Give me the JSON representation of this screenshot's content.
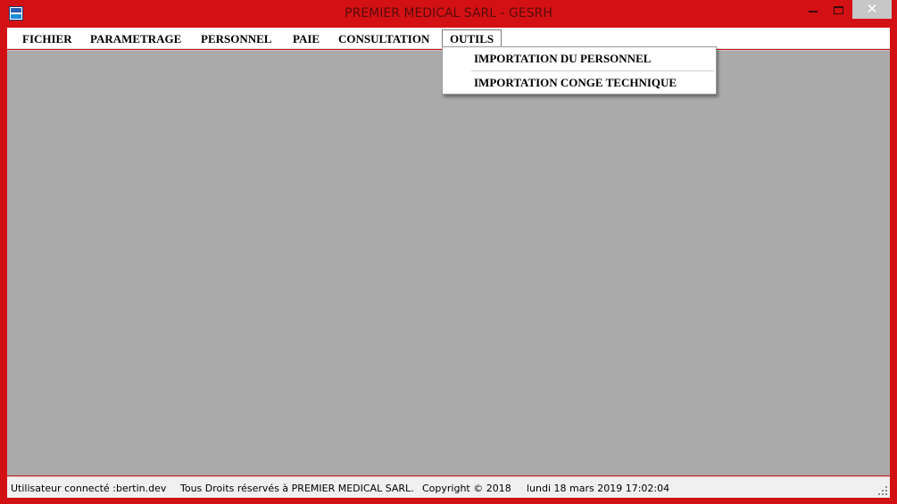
{
  "window": {
    "title": "PREMIER MEDICAL SARL - GESRH",
    "controls": {
      "minimize_icon": "minimize-icon",
      "maximize_icon": "maximize-icon",
      "close_glyph": "✕"
    }
  },
  "colors": {
    "frame": "#d31115",
    "client_background": "#aaaaaa",
    "menubar_background": "#ffffff",
    "statusbar_background": "#f0f0f0"
  },
  "menubar": {
    "items": [
      {
        "label": "FICHIER"
      },
      {
        "label": "PARAMETRAGE"
      },
      {
        "label": "PERSONNEL"
      },
      {
        "label": "PAIE"
      },
      {
        "label": "CONSULTATION"
      },
      {
        "label": "OUTILS",
        "open": true
      }
    ]
  },
  "outils_menu": {
    "items": [
      {
        "label": "IMPORTATION DU PERSONNEL"
      },
      {
        "label": "IMPORTATION CONGE TECHNIQUE"
      }
    ]
  },
  "statusbar": {
    "user_label": "Utilisateur connecté :",
    "user_value": "bertin.dev",
    "rights": "Tous Droits réservés à PREMIER MEDICAL SARL.",
    "copyright": "Copyright © 2018",
    "datetime": "lundi 18 mars 2019 17:02:04"
  }
}
